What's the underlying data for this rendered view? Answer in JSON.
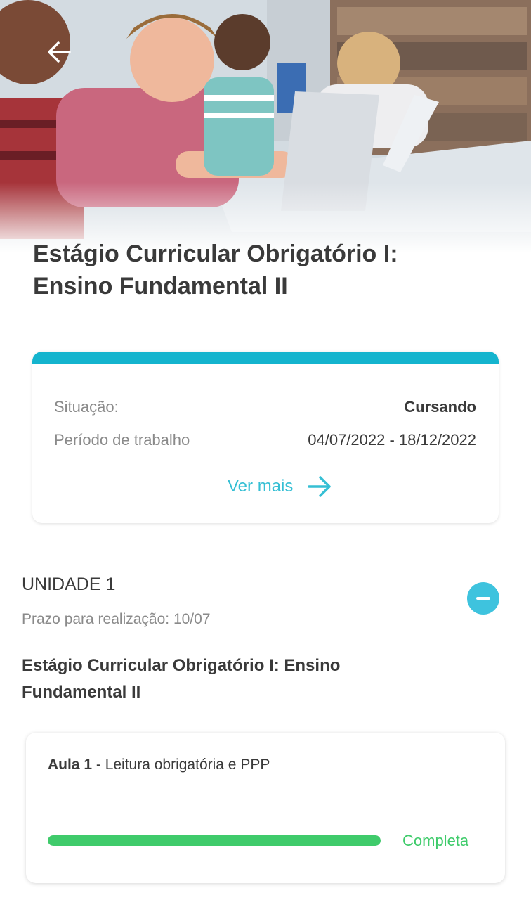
{
  "header": {
    "back_icon": "arrow-left-icon",
    "hero_image": "students-using-laptops-in-library"
  },
  "course": {
    "title_line1": "Estágio Curricular Obrigatório I:",
    "title_line2": "Ensino Fundamental II"
  },
  "info_card": {
    "accent_color": "#14b4ce",
    "status_label": "Situação:",
    "status_value": "Cursando",
    "period_label": "Período de trabalho",
    "period_value": "04/07/2022 - 18/12/2022",
    "more_label": "Ver mais",
    "more_icon": "arrow-right-icon"
  },
  "unit": {
    "title": "UNIDADE 1",
    "deadline": "Prazo para realização: 10/07",
    "collapse_icon": "minus-circle-icon",
    "subtitle_line1": "Estágio Curricular Obrigatório I: Ensino",
    "subtitle_line2": "Fundamental II"
  },
  "lesson": {
    "number": "Aula 1",
    "name": " - Leitura obrigatória e PPP",
    "progress": 1.0,
    "status": "Completa",
    "progress_color": "#3fcb6b"
  }
}
